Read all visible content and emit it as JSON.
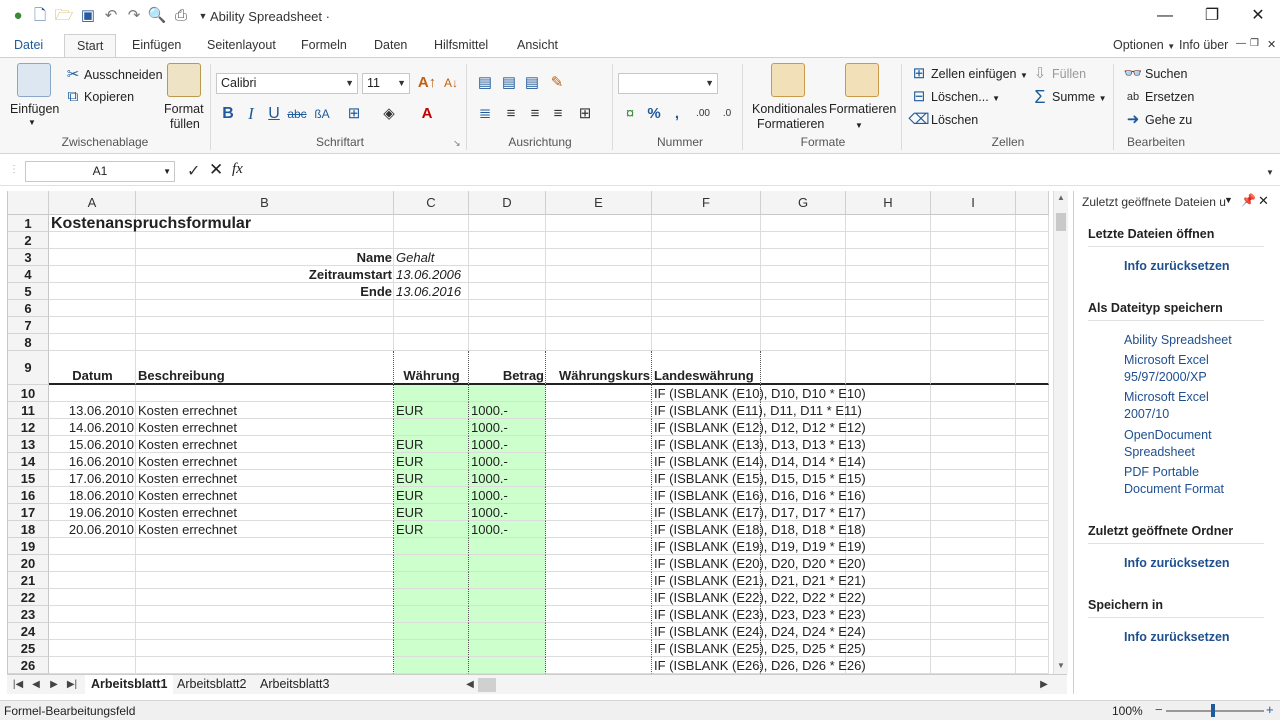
{
  "app": {
    "title": "Ability Spreadsheet ·"
  },
  "ribbon_tabs": {
    "file": "Datei",
    "start": "Start",
    "insert": "Einfügen",
    "layout": "Seitenlayout",
    "formulas": "Formeln",
    "data": "Daten",
    "tools": "Hilfsmittel",
    "view": "Ansicht",
    "options": "Optionen",
    "info": "Info über"
  },
  "ribbon": {
    "clipboard": {
      "paste": "Einfügen",
      "cut": "Ausschneiden",
      "copy": "Kopieren",
      "format_fill_1": "Format",
      "format_fill_2": "füllen",
      "label": "Zwischenablage"
    },
    "font": {
      "name": "Calibri",
      "size": "11",
      "label": "Schriftart"
    },
    "alignment": {
      "label": "Ausrichtung"
    },
    "number": {
      "format": "",
      "label": "Nummer"
    },
    "styles": {
      "cond_1": "Konditionales",
      "cond_2": "Formatieren",
      "format": "Formatieren",
      "label": "Formate"
    },
    "cells": {
      "insert": "Zellen einfügen",
      "delete_menu": "Löschen...",
      "delete": "Löschen",
      "fill": "Füllen",
      "sum": "Summe",
      "label": "Zellen"
    },
    "edit": {
      "find": "Suchen",
      "replace": "Ersetzen",
      "goto": "Gehe zu",
      "label": "Bearbeiten"
    }
  },
  "formula_bar": {
    "cell_ref": "A1",
    "fx": "fx",
    "value": ""
  },
  "columns": [
    "A",
    "B",
    "C",
    "D",
    "E",
    "F",
    "G",
    "H",
    "I"
  ],
  "rows": [
    "1",
    "2",
    "3",
    "4",
    "5",
    "6",
    "7",
    "8",
    "9",
    "10",
    "11",
    "12",
    "13",
    "14",
    "15",
    "16",
    "17",
    "18",
    "19",
    "20",
    "21",
    "22",
    "23",
    "24",
    "25",
    "26"
  ],
  "sheet": {
    "title": "Kostenanspruchsformular",
    "labels": {
      "name": "Name",
      "start": "Zeitraumstart",
      "end": "Ende"
    },
    "values": {
      "name": "Gehalt",
      "start": "13.06.2006",
      "end": "13.06.2016"
    },
    "headers": {
      "date": "Datum",
      "desc": "Beschreibung",
      "currency": "Währung",
      "amount": "Betrag",
      "rate": "Währungskurs",
      "local": "Landeswährung"
    },
    "data_rows": [
      {
        "date": "",
        "desc": "",
        "cur": "",
        "amt": "",
        "formula": "IF (ISBLANK (E10), D10, D10 * E10)"
      },
      {
        "date": "13.06.2010",
        "desc": "Kosten errechnet",
        "cur": "EUR",
        "amt": "1000.-",
        "formula": "IF (ISBLANK (E11), D11, D11 * E11)"
      },
      {
        "date": "14.06.2010",
        "desc": "Kosten errechnet",
        "cur": "",
        "amt": "1000.-",
        "formula": "IF (ISBLANK (E12), D12, D12 * E12)"
      },
      {
        "date": "15.06.2010",
        "desc": "Kosten errechnet",
        "cur": "EUR",
        "amt": "1000.-",
        "formula": "IF (ISBLANK (E13), D13, D13 * E13)"
      },
      {
        "date": "16.06.2010",
        "desc": "Kosten errechnet",
        "cur": "EUR",
        "amt": "1000.-",
        "formula": "IF (ISBLANK (E14), D14, D14 * E14)"
      },
      {
        "date": "17.06.2010",
        "desc": "Kosten errechnet",
        "cur": "EUR",
        "amt": "1000.-",
        "formula": "IF (ISBLANK (E15), D15, D15 * E15)"
      },
      {
        "date": "18.06.2010",
        "desc": "Kosten errechnet",
        "cur": "EUR",
        "amt": "1000.-",
        "formula": "IF (ISBLANK (E16), D16, D16 * E16)"
      },
      {
        "date": "19.06.2010",
        "desc": "Kosten errechnet",
        "cur": "EUR",
        "amt": "1000.-",
        "formula": "IF (ISBLANK (E17), D17, D17 * E17)"
      },
      {
        "date": "20.06.2010",
        "desc": "Kosten errechnet",
        "cur": "EUR",
        "amt": "1000.-",
        "formula": "IF (ISBLANK (E18), D18, D18 * E18)"
      },
      {
        "date": "",
        "desc": "",
        "cur": "",
        "amt": "",
        "formula": "IF (ISBLANK (E19), D19, D19 * E19)"
      },
      {
        "date": "",
        "desc": "",
        "cur": "",
        "amt": "",
        "formula": "IF (ISBLANK (E20), D20, D20 * E20)"
      },
      {
        "date": "",
        "desc": "",
        "cur": "",
        "amt": "",
        "formula": "IF (ISBLANK (E21), D21, D21 * E21)"
      },
      {
        "date": "",
        "desc": "",
        "cur": "",
        "amt": "",
        "formula": "IF (ISBLANK (E22), D22, D22 * E22)"
      },
      {
        "date": "",
        "desc": "",
        "cur": "",
        "amt": "",
        "formula": "IF (ISBLANK (E23), D23, D23 * E23)"
      },
      {
        "date": "",
        "desc": "",
        "cur": "",
        "amt": "",
        "formula": "IF (ISBLANK (E24), D24, D24 * E24)"
      },
      {
        "date": "",
        "desc": "",
        "cur": "",
        "amt": "",
        "formula": "IF (ISBLANK (E25), D25, D25 * E25)"
      },
      {
        "date": "",
        "desc": "",
        "cur": "",
        "amt": "",
        "formula": "IF (ISBLANK (E26), D26, D26 * E26)"
      }
    ]
  },
  "sheet_tabs": [
    "Arbeitsblatt1",
    "Arbeitsblatt2",
    "Arbeitsblatt3"
  ],
  "side_panel": {
    "title": "Zuletzt geöffnete Dateien u",
    "recent_files": "Letzte Dateien öffnen",
    "reset": "Info zurücksetzen",
    "save_as": "Als Dateityp speichern",
    "types": [
      {
        "l1": "Ability Spreadsheet",
        "l2": ""
      },
      {
        "l1": "Microsoft Excel",
        "l2": "95/97/2000/XP"
      },
      {
        "l1": "Microsoft Excel",
        "l2": "2007/10"
      },
      {
        "l1": "OpenDocument",
        "l2": "Spreadsheet"
      },
      {
        "l1": "PDF Portable",
        "l2": "Document Format"
      }
    ],
    "recent_folders": "Zuletzt geöffnete Ordner",
    "save_in": "Speichern in"
  },
  "status": {
    "text": "Formel-Bearbeitungsfeld",
    "zoom": "100%"
  },
  "colors": {
    "accent": "#1f5a9a",
    "green_fill": "#ccffcc"
  }
}
